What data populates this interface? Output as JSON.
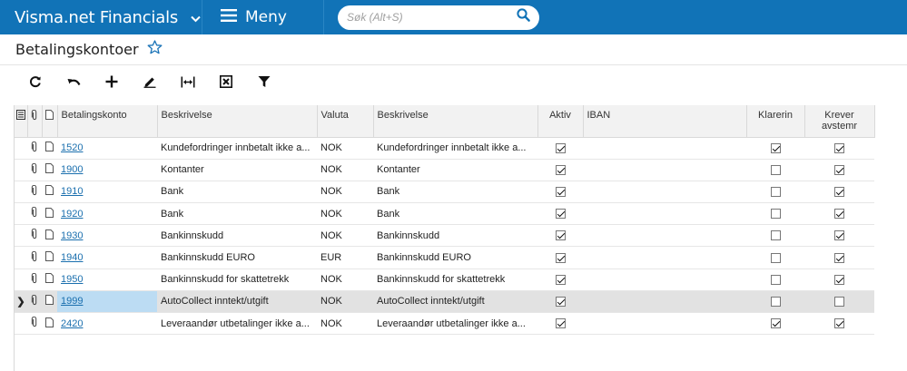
{
  "header": {
    "brand": "Visma.net Financials",
    "menu_label": "Meny",
    "search_placeholder": "Søk (Alt+S)"
  },
  "page": {
    "title": "Betalingskontoer"
  },
  "toolbar": [
    "refresh-icon",
    "undo-icon",
    "add-icon",
    "edit-icon",
    "fit-width-icon",
    "excel-export-icon",
    "filter-icon"
  ],
  "grid": {
    "columns": {
      "account": "Betalingskonto",
      "description": "Beskrivelse",
      "currency": "Valuta",
      "description2": "Beskrivelse",
      "active": "Aktiv",
      "iban": "IBAN",
      "clears": "Klarerin",
      "reconcile": "Krever avstemr"
    },
    "rows": [
      {
        "account": "1520",
        "description": "Kundefordringer innbetalt ikke a...",
        "currency": "NOK",
        "description2": "Kundefordringer innbetalt ikke a...",
        "active": true,
        "iban": "",
        "clears": true,
        "reconcile": true
      },
      {
        "account": "1900",
        "description": "Kontanter",
        "currency": "NOK",
        "description2": "Kontanter",
        "active": true,
        "iban": "",
        "clears": false,
        "reconcile": true
      },
      {
        "account": "1910",
        "description": "Bank",
        "currency": "NOK",
        "description2": "Bank",
        "active": true,
        "iban": "",
        "clears": false,
        "reconcile": true
      },
      {
        "account": "1920",
        "description": "Bank",
        "currency": "NOK",
        "description2": "Bank",
        "active": true,
        "iban": "",
        "clears": false,
        "reconcile": true
      },
      {
        "account": "1930",
        "description": "Bankinnskudd",
        "currency": "NOK",
        "description2": "Bankinnskudd",
        "active": true,
        "iban": "",
        "clears": false,
        "reconcile": true
      },
      {
        "account": "1940",
        "description": "Bankinnskudd EURO",
        "currency": "EUR",
        "description2": "Bankinnskudd EURO",
        "active": true,
        "iban": "",
        "clears": false,
        "reconcile": true
      },
      {
        "account": "1950",
        "description": "Bankinnskudd for skattetrekk",
        "currency": "NOK",
        "description2": "Bankinnskudd for skattetrekk",
        "active": true,
        "iban": "",
        "clears": false,
        "reconcile": true
      },
      {
        "account": "1999",
        "description": "AutoCollect inntekt/utgift",
        "currency": "NOK",
        "description2": "AutoCollect inntekt/utgift",
        "active": true,
        "iban": "",
        "clears": false,
        "reconcile": false,
        "selected": true
      },
      {
        "account": "2420",
        "description": "Leveraandør utbetalinger ikke a...",
        "currency": "NOK",
        "description2": "Leveraandør utbetalinger ikke a...",
        "active": true,
        "iban": "",
        "clears": true,
        "reconcile": true
      }
    ]
  },
  "colors": {
    "topbar": "#1173b7",
    "link": "#1a6fae",
    "selected_row": "#e2e2e2",
    "selected_cell": "#bcdcf3"
  }
}
